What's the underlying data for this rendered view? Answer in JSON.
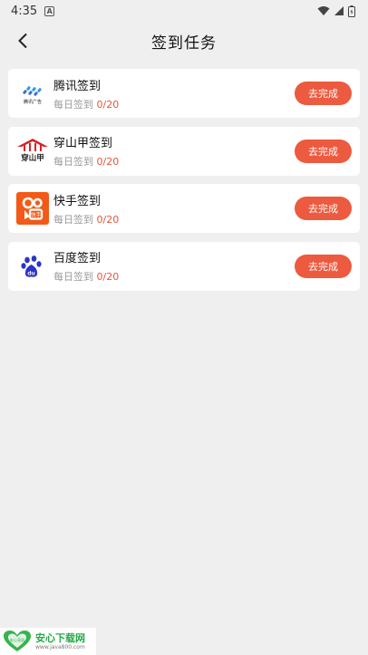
{
  "status_bar": {
    "time": "4:35",
    "notification_letter": "A"
  },
  "header": {
    "title": "签到任务"
  },
  "tasks": [
    {
      "name": "腾讯签到",
      "progress_label": "每日签到 ",
      "progress_count": "0/20",
      "button_label": "去完成",
      "logo_caption": "腾讯广告",
      "logo": "tencent-ads-logo"
    },
    {
      "name": "穿山甲签到",
      "progress_label": "每日签到 ",
      "progress_count": "0/20",
      "button_label": "去完成",
      "logo_caption": "穿山甲",
      "logo": "pangle-logo"
    },
    {
      "name": "快手签到",
      "progress_label": "每日签到 ",
      "progress_count": "0/20",
      "button_label": "去完成",
      "logo_caption": "",
      "logo": "kuaishou-logo"
    },
    {
      "name": "百度签到",
      "progress_label": "每日签到 ",
      "progress_count": "0/20",
      "button_label": "去完成",
      "logo_caption": "du",
      "logo": "baidu-paw-logo"
    }
  ],
  "watermark": {
    "title": "安心下载网",
    "url": "www.java800.com",
    "badge_text": "安心家园"
  },
  "colors": {
    "accent": "#ec5a3f",
    "count": "#e8553b",
    "background": "#efefef"
  }
}
